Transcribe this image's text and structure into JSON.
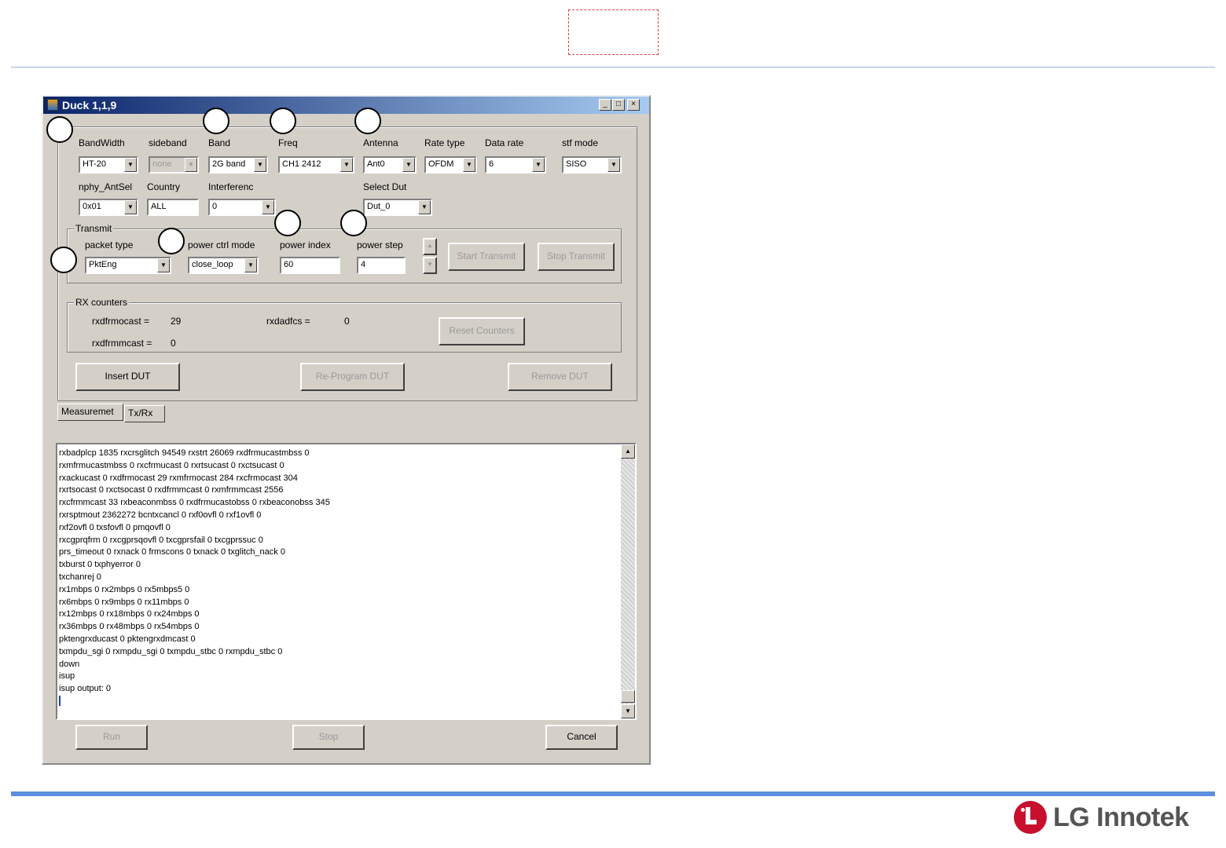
{
  "window": {
    "title": "Duck 1,1,9",
    "min": "_",
    "max": "□",
    "close": "×"
  },
  "config": {
    "bandwidth": {
      "label": "BandWidth",
      "value": "HT-20"
    },
    "sideband": {
      "label": "sideband",
      "value": "none"
    },
    "band": {
      "label": "Band",
      "value": "2G band"
    },
    "freq": {
      "label": "Freq",
      "value": "CH1 2412"
    },
    "antenna": {
      "label": "Antenna",
      "value": "Ant0"
    },
    "rate_type": {
      "label": "Rate type",
      "value": "OFDM"
    },
    "data_rate": {
      "label": "Data rate",
      "value": "6"
    },
    "stf_mode": {
      "label": "stf mode",
      "value": "SISO"
    },
    "nphy_antsel": {
      "label": "nphy_AntSel",
      "value": "0x01"
    },
    "country": {
      "label": "Country",
      "value": "ALL"
    },
    "interference": {
      "label": "Interferenc",
      "value": "0"
    },
    "select_dut": {
      "label": "Select Dut",
      "value": "Dut_0"
    }
  },
  "transmit": {
    "group_label": "Transmit",
    "packet_type": {
      "label": "packet type",
      "value": "PktEng"
    },
    "power_ctrl_mode": {
      "label": "power ctrl mode",
      "value": "close_loop"
    },
    "power_index": {
      "label": "power index",
      "value": "60"
    },
    "power_step": {
      "label": "power step",
      "value": "4"
    },
    "start": "Start Transmit",
    "stop": "Stop Transmit"
  },
  "rx": {
    "group_label": "RX counters",
    "rxdfrmocast_label": "rxdfrmocast =",
    "rxdfrmocast_value": "29",
    "rxdfrmmcast_label": "rxdfrmmcast =",
    "rxdfrmmcast_value": "0",
    "rxbadfcs_label": "rxdadfcs =",
    "rxbadfcs_value": "0",
    "reset": "Reset Counters"
  },
  "dut_buttons": {
    "insert": "Insert DUT",
    "reprogram": "Re-Program DUT",
    "remove": "Remove DUT"
  },
  "tabs": [
    "Measuremet",
    "Tx/Rx"
  ],
  "log_lines": [
    "rxbadplcp 1835 rxcrsglitch 94549 rxstrt 26069 rxdfrmucastmbss 0",
    "rxmfrmucastmbss 0 rxcfrmucast 0 rxrtsucast 0 rxctsucast 0",
    "rxackucast 0 rxdfrmocast 29 rxmfrmocast 284 rxcfrmocast 304",
    "rxrtsocast 0 rxctsocast 0 rxdfrmmcast 0 rxmfrmmcast 2556",
    "rxcfrmmcast 33 rxbeaconmbss 0 rxdfrmucastobss 0 rxbeaconobss 345",
    "rxrsptmout 2362272 bcntxcancl 0 rxf0ovfl 0 rxf1ovfl 0",
    "rxf2ovfl 0 txsfovfl 0 pmqovfl 0",
    "rxcgprqfrm 0 rxcgprsqovfl 0 txcgprsfail 0 txcgprssuc 0",
    "prs_timeout 0 rxnack 0 frmscons 0 txnack 0 txglitch_nack 0",
    "txburst 0 txphyerror 0",
    "txchanrej 0",
    "rx1mbps 0 rx2mbps 0 rx5mbps5 0",
    "rx6mbps 0 rx9mbps 0 rx11mbps 0",
    "rx12mbps 0 rx18mbps 0 rx24mbps 0",
    "rx36mbps 0 rx48mbps 0 rx54mbps 0",
    "pktengrxducast 0 pktengrxdmcast 0",
    "txmpdu_sgi 0 rxmpdu_sgi 0 txmpdu_stbc 0 rxmpdu_stbc 0",
    "down",
    "isup",
    "isup output: 0"
  ],
  "bottom_buttons": {
    "run": "Run",
    "stop": "Stop",
    "cancel": "Cancel"
  },
  "brand": {
    "name": "LG Innotek",
    "color": "#c8102e"
  }
}
